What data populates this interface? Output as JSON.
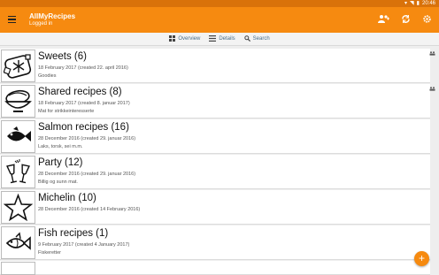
{
  "status_bar": {
    "time": "20:46",
    "icons": [
      "sim-icon",
      "wifi-icon",
      "battery-icon"
    ]
  },
  "app_bar": {
    "title": "AllMyRecipes",
    "subtitle": "Logged in",
    "actions": [
      "add-group-icon",
      "sync-icon",
      "settings-icon"
    ]
  },
  "toolbar": {
    "overview": "Overview",
    "details": "Details",
    "search": "Search"
  },
  "categories": [
    {
      "title": "Sweets (6)",
      "date": "18 February 2017 (created 22. april 2016)",
      "desc": "Goodies",
      "icon": "snowflake-icon",
      "shared": true
    },
    {
      "title": "Shared recipes (8)",
      "date": "18 February 2017 (created 8. januar 2017)",
      "desc": "Mat for strikkeinteresserte",
      "icon": "bowl-icon",
      "shared": true
    },
    {
      "title": "Salmon recipes (16)",
      "date": "28 December 2016 (created 29. januar 2016)",
      "desc": "Laks, torsk, sei m.m.",
      "icon": "fish-icon",
      "shared": false
    },
    {
      "title": "Party (12)",
      "date": "28 December 2016 (created 29. januar 2016)",
      "desc": "Billig og sunn mat.",
      "icon": "champagne-icon",
      "shared": false
    },
    {
      "title": "Michelin (10)",
      "date": "28 December 2016 (created 14 February 2016)",
      "desc": "",
      "icon": "star-icon",
      "shared": false
    },
    {
      "title": "Fish recipes (1)",
      "date": "9 February 2017 (created 4 January 2017)",
      "desc": "Fiskeretter",
      "icon": "fish-outline-icon",
      "shared": false
    }
  ],
  "fab": {
    "label": "+"
  },
  "colors": {
    "accent": "#f68a10",
    "status": "#d9720a"
  }
}
